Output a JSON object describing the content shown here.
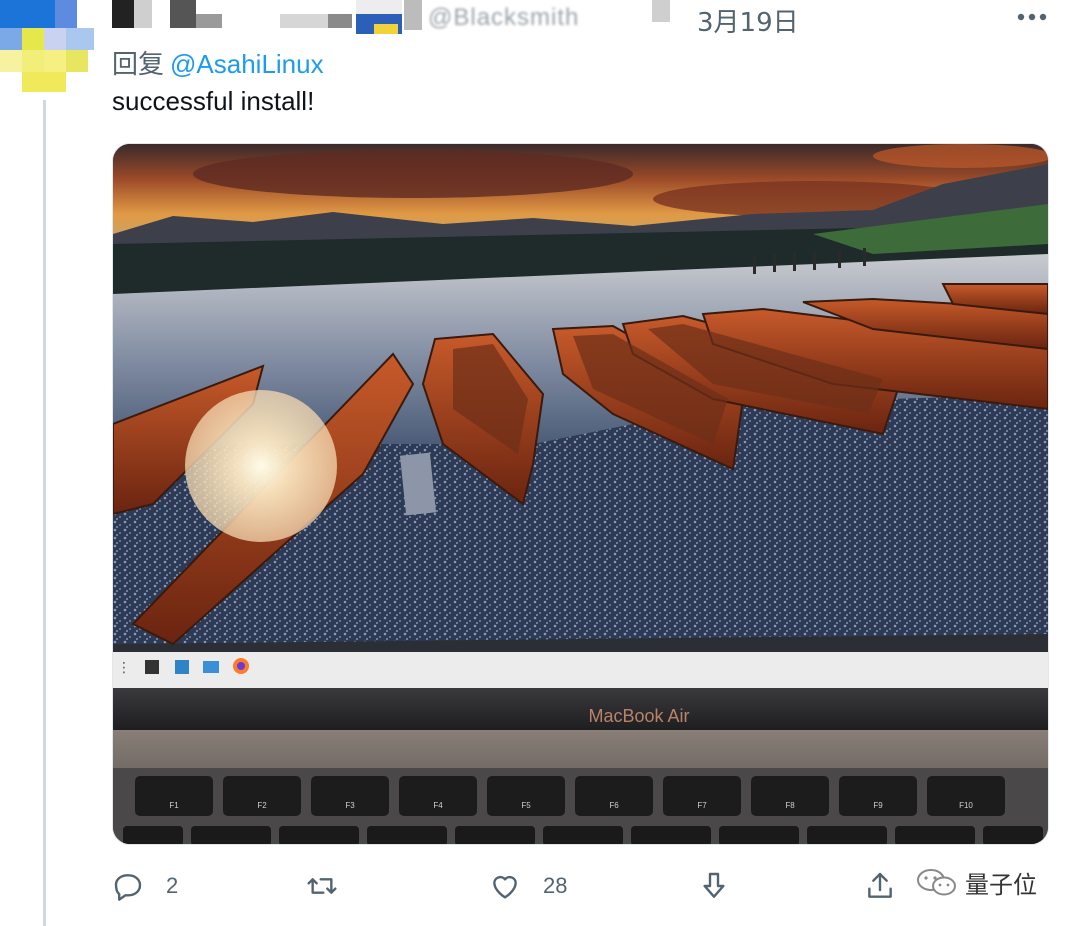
{
  "tweet": {
    "handle_blurred": "@Blacksmith",
    "date": "3月19日",
    "reply_prefix": "回复",
    "reply_mention": "@AsahiLinux",
    "text": "successful install!"
  },
  "media": {
    "laptop_label": "MacBook Air",
    "fn_keys": [
      "F1",
      "F2",
      "F3",
      "F4",
      "F5",
      "F6",
      "F7",
      "F8",
      "F9",
      "F10"
    ]
  },
  "actions": {
    "reply_count": "2",
    "retweet_count": "",
    "like_count": "28"
  },
  "watermark": {
    "text": "量子位"
  },
  "colors": {
    "link": "#1d9bf0",
    "secondary_text": "#536471",
    "thread_line": "#cfd9de"
  }
}
